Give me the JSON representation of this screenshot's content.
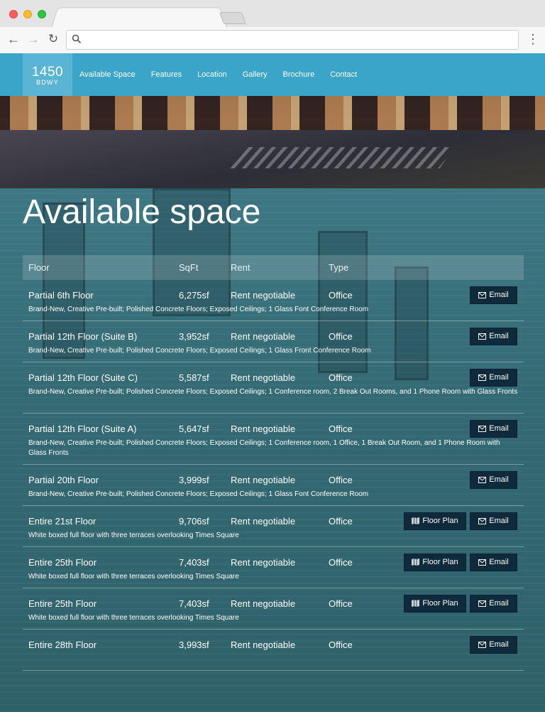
{
  "brand": {
    "number": "1450",
    "sub": "BDWY"
  },
  "nav": [
    "Available Space",
    "Features",
    "Location",
    "Gallery",
    "Brochure",
    "Contact"
  ],
  "heading": "Available space",
  "table": {
    "headers": {
      "floor": "Floor",
      "sqft": "SqFt",
      "rent": "Rent",
      "type": "Type"
    },
    "rows": [
      {
        "floor": "Partial 6th Floor",
        "sqft": "6,275sf",
        "rent": "Rent negotiable",
        "type": "Office",
        "desc": "Brand-New, Creative Pre-built; Polished Concrete Floors; Exposed Ceilings; 1 Glass Font Conference Room",
        "plan": false
      },
      {
        "floor": "Partial 12th Floor (Suite B)",
        "sqft": "3,952sf",
        "rent": "Rent negotiable",
        "type": "Office",
        "desc": "Brand-New, Creative Pre-built; Polished Concrete Floors; Exposed Ceilings; 1 Glass Front Conference Room",
        "plan": false
      },
      {
        "floor": "Partial 12th Floor (Suite C)",
        "sqft": "5,587sf",
        "rent": "Rent negotiable",
        "type": "Office",
        "desc": "Brand-New, Creative Pre-built; Polished Concrete Floors; Exposed Ceilings; 1 Conference room, 2 Break Out Rooms, and 1 Phone Room with Glass Fronts",
        "plan": false
      },
      {
        "floor": "Partial 12th Floor (Suite A)",
        "sqft": "5,647sf",
        "rent": "Rent negotiable",
        "type": "Office",
        "desc": "Brand-New, Creative Pre-built; Polished Concrete Floors; Exposed Ceilings; 1 Conference room, 1 Office, 1 Break Out Room, and 1 Phone Room with Glass Fronts",
        "plan": false
      },
      {
        "floor": "Partial 20th Floor",
        "sqft": "3,999sf",
        "rent": "Rent negotiable",
        "type": "Office",
        "desc": "Brand-New, Creative Pre-built; Polished Concrete Floors; Exposed Ceilings; 1 Glass Font Conference Room",
        "plan": false
      },
      {
        "floor": "Entire 21st Floor",
        "sqft": "9,706sf",
        "rent": "Rent negotiable",
        "type": "Office",
        "desc": "White boxed full floor with three terraces overlooking Times Square",
        "plan": true
      },
      {
        "floor": "Entire 25th Floor",
        "sqft": "7,403sf",
        "rent": "Rent negotiable",
        "type": "Office",
        "desc": "White boxed full floor with three terraces overlooking Times Square",
        "plan": true
      },
      {
        "floor": "Entire 25th Floor",
        "sqft": "7,403sf",
        "rent": "Rent negotiable",
        "type": "Office",
        "desc": "White boxed full floor with three terraces overlooking Times Square",
        "plan": true
      },
      {
        "floor": "Entire 28th Floor",
        "sqft": "3,993sf",
        "rent": "Rent negotiable",
        "type": "Office",
        "desc": "",
        "plan": false
      }
    ]
  },
  "buttons": {
    "email": "Email",
    "floor_plan": "Floor Plan"
  },
  "colors": {
    "nav_bg": "#3ba5c9",
    "logo_bg": "#5ab5d4",
    "button_bg": "#0f2a3a"
  }
}
